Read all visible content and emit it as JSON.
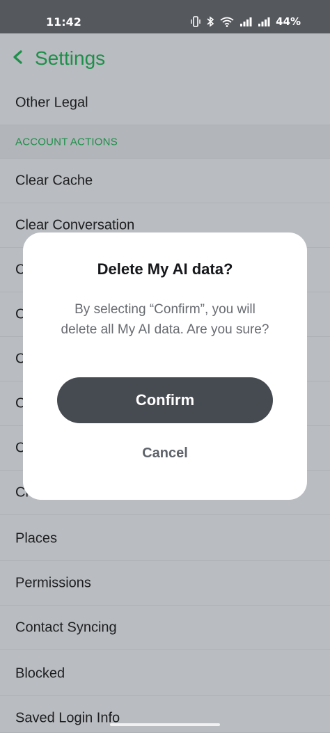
{
  "status_bar": {
    "time": "11:42",
    "battery": "44%",
    "icons": [
      "vibrate-icon",
      "bluetooth-icon",
      "wifi-icon",
      "signal-icon",
      "signal-icon"
    ]
  },
  "header": {
    "title": "Settings"
  },
  "list": {
    "row_other_legal": "Other Legal",
    "section_account_actions": "ACCOUNT ACTIONS",
    "row_clear_cache": "Clear Cache",
    "row_clear_conversation": "Clear Conversation",
    "row_partial_1": "C",
    "row_partial_2": "C",
    "row_partial_3": "C",
    "row_partial_4": "C",
    "row_partial_5": "C",
    "row_partial_6": "Cle",
    "row_places": "Places",
    "row_permissions": "Permissions",
    "row_contact_syncing": "Contact Syncing",
    "row_blocked": "Blocked",
    "row_saved_login_info": "Saved Login Info"
  },
  "dialog": {
    "title": "Delete My AI data?",
    "message": "By selecting “Confirm”, you will delete all My AI data. Are you sure?",
    "confirm_label": "Confirm",
    "cancel_label": "Cancel"
  },
  "colors": {
    "accent": "#1e8f4a",
    "overlay_bg": "#b9bcc0",
    "button_dark": "#464a51"
  }
}
